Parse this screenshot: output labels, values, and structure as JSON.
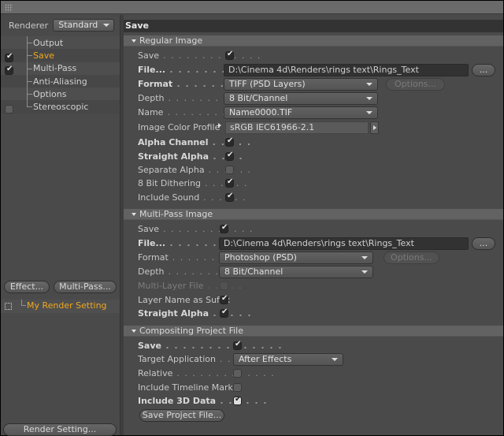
{
  "left": {
    "renderer_label": "Renderer",
    "renderer_value": "Standard",
    "tree": [
      {
        "label": "Output",
        "check": "none",
        "active": false
      },
      {
        "label": "Save",
        "check": "on",
        "active": true
      },
      {
        "label": "Multi-Pass",
        "check": "on",
        "active": false
      },
      {
        "label": "Anti-Aliasing",
        "check": "none",
        "active": false
      },
      {
        "label": "Options",
        "check": "none",
        "active": false
      },
      {
        "label": "Stereoscopic",
        "check": "off",
        "active": false
      }
    ],
    "effect_button": "Effect...",
    "multipass_button": "Multi-Pass...",
    "render_setting_name": "My Render Setting",
    "render_setting_button": "Render Setting..."
  },
  "right": {
    "title": "Save",
    "regular_image": {
      "header": "Regular Image",
      "save_label": "Save",
      "save_checked": true,
      "file_label": "File...",
      "file_value": "D:\\Cinema 4d\\Renders\\rings text\\Rings_Text",
      "browse_button": "...",
      "format_label": "Format",
      "format_value": "TIFF (PSD Layers)",
      "options_button": "Options...",
      "depth_label": "Depth",
      "depth_value": "8 Bit/Channel",
      "name_label": "Name",
      "name_value": "Name0000.TIF",
      "profile_label": "Image Color Profile",
      "profile_value": "sRGB IEC61966-2.1",
      "alpha_channel_label": "Alpha Channel",
      "alpha_channel_checked": true,
      "straight_alpha_label": "Straight Alpha",
      "straight_alpha_checked": true,
      "separate_alpha_label": "Separate Alpha",
      "separate_alpha_checked": false,
      "dithering_label": "8 Bit Dithering",
      "dithering_checked": true,
      "include_sound_label": "Include Sound",
      "include_sound_checked": true
    },
    "multi_pass": {
      "header": "Multi-Pass Image",
      "save_label": "Save",
      "save_checked": true,
      "file_label": "File...",
      "file_value": "D:\\Cinema 4d\\Renders\\rings text\\Rings_Text",
      "browse_button": "...",
      "format_label": "Format",
      "format_value": "Photoshop (PSD)",
      "options_button": "Options...",
      "depth_label": "Depth",
      "depth_value": "8 Bit/Channel",
      "multilayer_label": "Multi-Layer File",
      "multilayer_checked": false,
      "layer_suffix_label": "Layer Name as Suffix",
      "layer_suffix_checked": true,
      "straight_alpha_label": "Straight Alpha",
      "straight_alpha_checked": true
    },
    "compositing": {
      "header": "Compositing Project File",
      "save_label": "Save",
      "save_checked": true,
      "target_label": "Target Application",
      "target_value": "After Effects",
      "relative_label": "Relative",
      "relative_checked": false,
      "timeline_label": "Include Timeline Marker",
      "timeline_checked": false,
      "data3d_label": "Include 3D Data",
      "data3d_checked": true,
      "save_project_button": "Save Project File..."
    }
  }
}
